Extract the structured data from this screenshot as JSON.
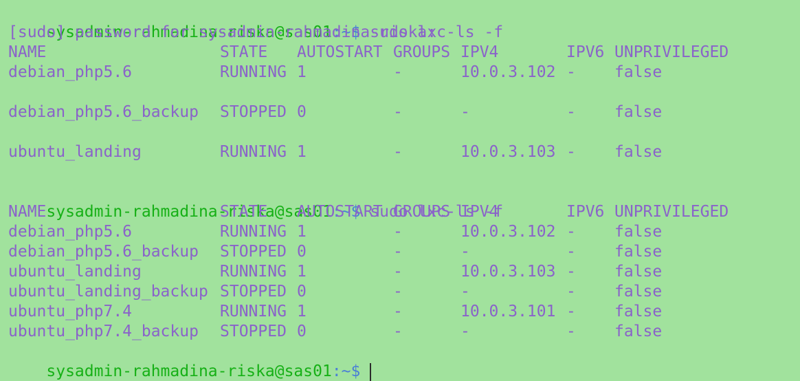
{
  "colors": {
    "background": "#a1e29d",
    "text": "#8a63c9",
    "user_host": "#16b016",
    "path": "#4a7fd6",
    "cursor": "#2b2b2b"
  },
  "prompt": {
    "user_host": "sysadmin-rahmadina-riska@sas01",
    "separator": ":",
    "path": "~",
    "symbol": "$"
  },
  "session1": {
    "command": "sudo lxc-ls -f",
    "sudo_prompt": "[sudo] password for sysadmin-rahmadina-riska:",
    "headers": [
      "NAME",
      "STATE",
      "AUTOSTART",
      "GROUPS",
      "IPV4",
      "IPV6",
      "UNPRIVILEGED"
    ],
    "rows": [
      [
        "debian_php5.6",
        "RUNNING",
        "1",
        "-",
        "10.0.3.102",
        "-",
        "false"
      ],
      [
        "debian_php5.6_backup",
        "STOPPED",
        "0",
        "-",
        "-",
        "-",
        "false"
      ],
      [
        "ubuntu_landing",
        "RUNNING",
        "1",
        "-",
        "10.0.3.103",
        "-",
        "false"
      ]
    ]
  },
  "session2": {
    "command": "sudo lxc-ls -f",
    "headers": [
      "NAME",
      "STATE",
      "AUTOSTART",
      "GROUPS",
      "IPV4",
      "IPV6",
      "UNPRIVILEGED"
    ],
    "rows": [
      [
        "debian_php5.6",
        "RUNNING",
        "1",
        "-",
        "10.0.3.102",
        "-",
        "false"
      ],
      [
        "debian_php5.6_backup",
        "STOPPED",
        "0",
        "-",
        "-",
        "-",
        "false"
      ],
      [
        "ubuntu_landing",
        "RUNNING",
        "1",
        "-",
        "10.0.3.103",
        "-",
        "false"
      ],
      [
        "ubuntu_landing_backup",
        "STOPPED",
        "0",
        "-",
        "-",
        "-",
        "false"
      ],
      [
        "ubuntu_php7.4",
        "RUNNING",
        "1",
        "-",
        "10.0.3.101",
        "-",
        "false"
      ],
      [
        "ubuntu_php7.4_backup",
        "STOPPED",
        "0",
        "-",
        "-",
        "-",
        "false"
      ]
    ]
  }
}
